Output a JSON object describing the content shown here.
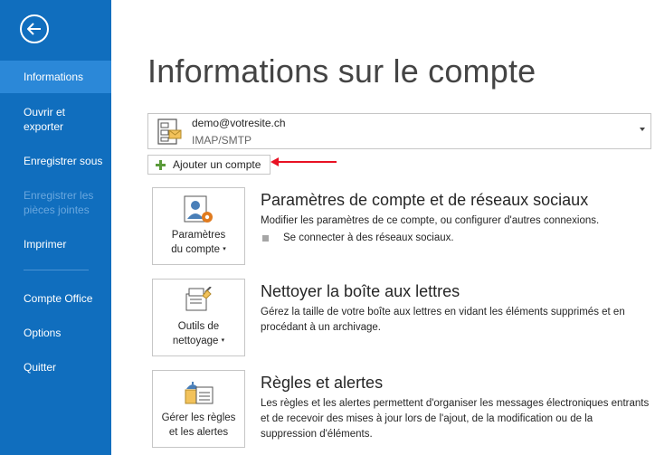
{
  "sidebar": {
    "back_icon": "back-arrow-icon",
    "items": [
      {
        "label": "Informations",
        "active": true,
        "enabled": true
      },
      {
        "label": "Ouvrir et\nexporter",
        "enabled": true
      },
      {
        "label": "Enregistrer sous",
        "enabled": true
      },
      {
        "label": "Enregistrer les\npièces jointes",
        "enabled": false
      },
      {
        "label": "Imprimer",
        "enabled": true
      },
      {
        "label": "Compte Office",
        "enabled": true
      },
      {
        "label": "Options",
        "enabled": true
      },
      {
        "label": "Quitter",
        "enabled": true
      }
    ]
  },
  "main": {
    "title": "Informations sur le compte",
    "account": {
      "email": "demo@votresite.ch",
      "type": "IMAP/SMTP",
      "icon": "mail-account-icon"
    },
    "add_account_label": "Ajouter un compte",
    "sections": [
      {
        "tile_label_1": "Paramètres",
        "tile_label_2": "du compte",
        "icon": "account-settings-icon",
        "title": "Paramètres de compte et de réseaux sociaux",
        "description": "Modifier les paramètres de ce compte, ou configurer d'autres connexions.",
        "link": "Se connecter à des réseaux sociaux."
      },
      {
        "tile_label_1": "Outils de",
        "tile_label_2": "nettoyage",
        "icon": "cleanup-tools-icon",
        "title": "Nettoyer la boîte aux lettres",
        "description": "Gérez la taille de votre boîte aux lettres en vidant les éléments supprimés et en procédant à un archivage."
      },
      {
        "tile_label_1": "Gérer les règles",
        "tile_label_2": "et les alertes",
        "icon": "rules-alerts-icon",
        "title": "Règles et alertes",
        "description": "Les règles et les alertes permettent d'organiser les messages électroniques entrants et de recevoir des mises à jour lors de l'ajout, de la modification ou de la suppression d'éléments."
      }
    ]
  },
  "colors": {
    "sidebar": "#106ebe",
    "sidebar_active": "#2b88d8",
    "annotation_arrow": "#e81123"
  }
}
